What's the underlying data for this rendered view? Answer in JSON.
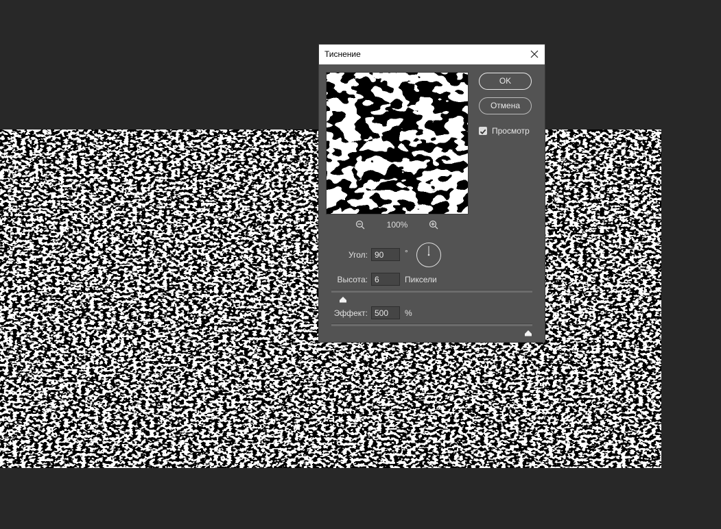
{
  "dialog": {
    "title": "Тиснение",
    "ok_label": "OK",
    "cancel_label": "Отмена",
    "preview_label": "Просмотр",
    "preview_checked": true,
    "zoom": "100%",
    "angle": {
      "label": "Угол:",
      "value": "90",
      "unit": "°"
    },
    "height": {
      "label": "Высота:",
      "value": "6",
      "unit": "Пиксели",
      "slider_fraction": 0.04
    },
    "amount": {
      "label": "Эффект:",
      "value": "500",
      "unit": "%",
      "slider_fraction": 1.0
    }
  },
  "icons": {
    "close": "close-icon",
    "zoom_out": "zoom-out-icon",
    "zoom_in": "zoom-in-icon",
    "checkbox": "checkmark-icon",
    "angle_dial": "angle-dial-icon"
  },
  "colors": {
    "workspace": "#282828",
    "dialog": "#535353",
    "titlebar": "#ffffff"
  }
}
